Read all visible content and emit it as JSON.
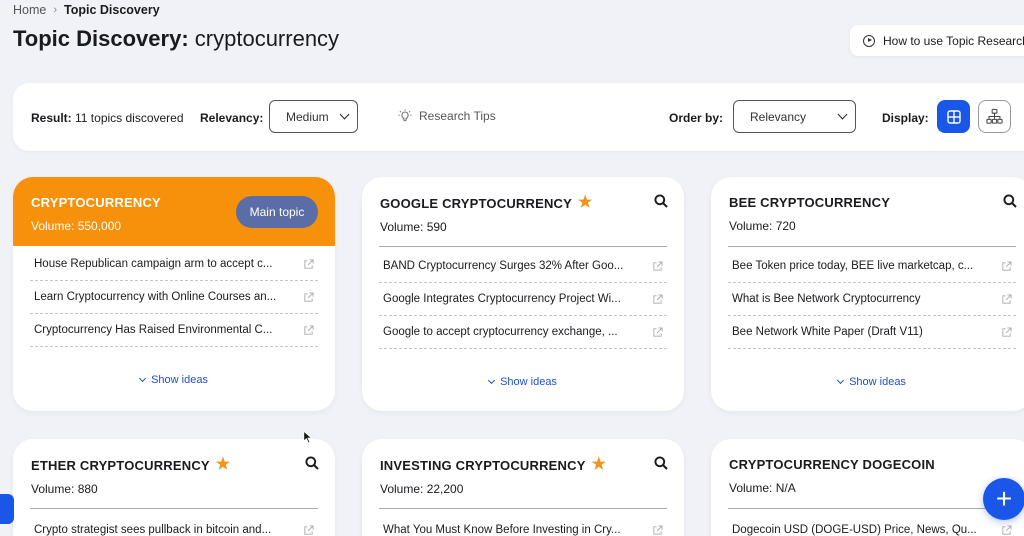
{
  "breadcrumb": {
    "home": "Home",
    "separator": "›",
    "current": "Topic Discovery"
  },
  "page": {
    "title_prefix": "Topic Discovery:",
    "keyword": "cryptocurrency"
  },
  "how_to": {
    "label": "How to use Topic Research",
    "icon": "play-circle-icon"
  },
  "toolbar": {
    "result_label": "Result:",
    "result_value": "11 topics discovered",
    "relevancy_label": "Relevancy:",
    "relevancy_value": "Medium",
    "research_tips": "Research Tips",
    "order_label": "Order by:",
    "order_value": "Relevancy",
    "display_label": "Display:",
    "display_mode": "grid",
    "accent": "#1a57e8"
  },
  "cards": [
    {
      "title": "CRYPTOCURRENCY",
      "volume": "Volume: 550,000",
      "main": true,
      "badge": "Main topic",
      "starred": false,
      "ideas": [
        "House Republican campaign arm to accept c...",
        "Learn Cryptocurrency with Online Courses an...",
        "Cryptocurrency Has Raised Environmental C..."
      ],
      "show_ideas": "Show ideas"
    },
    {
      "title": "GOOGLE CRYPTOCURRENCY",
      "volume": "Volume: 590",
      "main": false,
      "starred": true,
      "ideas": [
        "BAND Cryptocurrency Surges 32% After Goo...",
        "Google Integrates Cryptocurrency Project Wi...",
        "Google to accept cryptocurrency exchange, ..."
      ],
      "show_ideas": "Show ideas"
    },
    {
      "title": "BEE CRYPTOCURRENCY",
      "volume": "Volume: 720",
      "main": false,
      "starred": false,
      "ideas": [
        "Bee Token price today, BEE live marketcap, c...",
        "What is Bee Network Cryptocurrency",
        "Bee Network White Paper (Draft V11)"
      ],
      "show_ideas": "Show ideas"
    },
    {
      "title": "ETHER CRYPTOCURRENCY",
      "volume": "Volume: 880",
      "main": false,
      "starred": true,
      "ideas": [
        "Crypto strategist sees pullback in bitcoin and..."
      ]
    },
    {
      "title": "INVESTING CRYPTOCURRENCY",
      "volume": "Volume: 22,200",
      "main": false,
      "starred": true,
      "ideas": [
        "What You Must Know Before Investing in Cry..."
      ]
    },
    {
      "title": "CRYPTOCURRENCY DOGECOIN",
      "volume": "Volume: N/A",
      "main": false,
      "starred": false,
      "ideas": [
        "Dogecoin USD (DOGE-USD) Price, News, Qu..."
      ]
    }
  ],
  "fab": {
    "label": "+"
  },
  "colors": {
    "main_topic": "#f7900b",
    "star": "#f2931a",
    "badge": "#5b6da6",
    "link": "#2050c0"
  }
}
